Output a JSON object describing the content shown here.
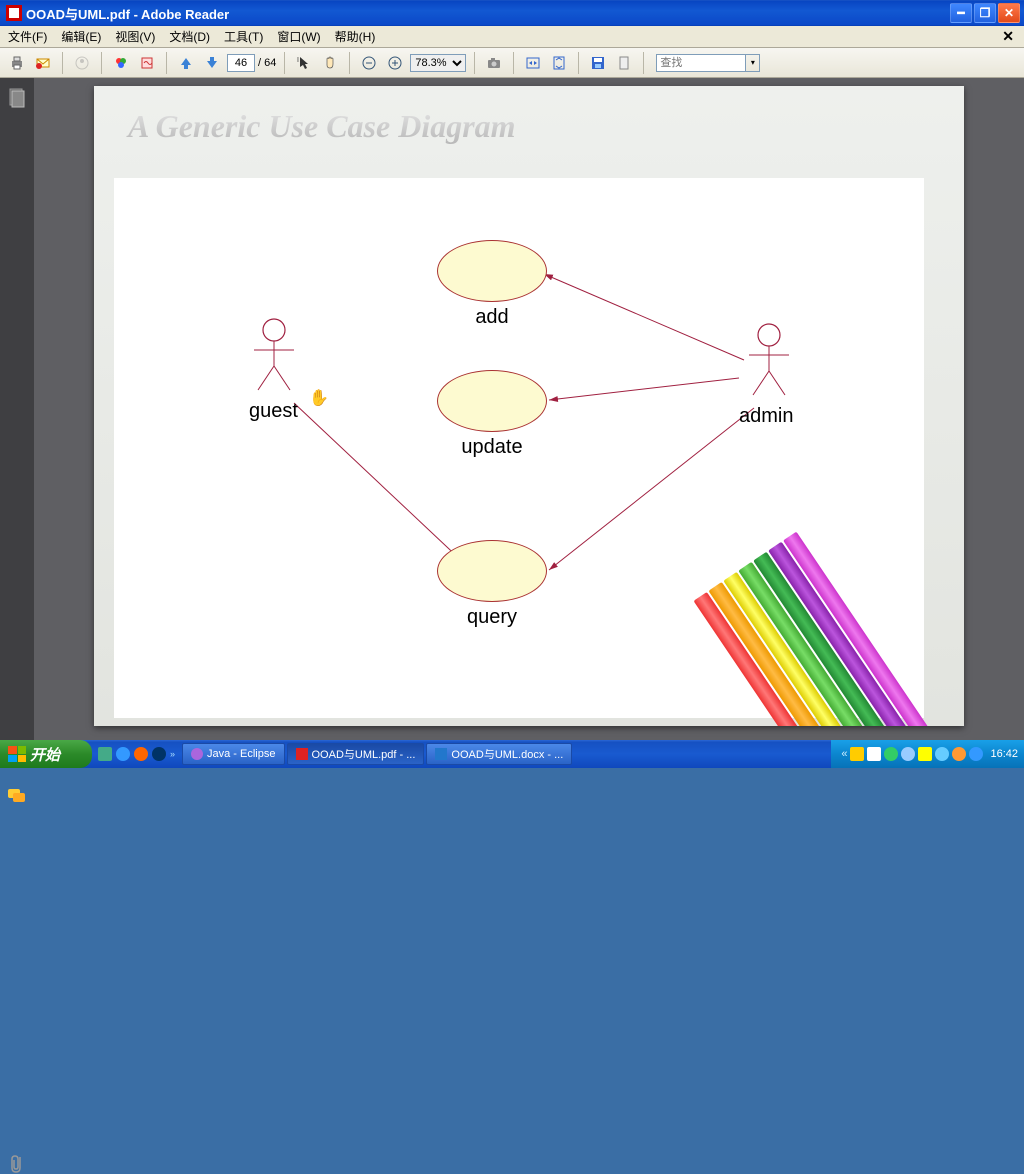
{
  "window": {
    "title": "OOAD与UML.pdf - Adobe Reader"
  },
  "menu": {
    "file": "文件(F)",
    "edit": "编辑(E)",
    "view": "视图(V)",
    "doc": "文档(D)",
    "tools": "工具(T)",
    "window": "窗口(W)",
    "help": "帮助(H)"
  },
  "toolbar": {
    "page": "46",
    "total": "/ 64",
    "zoom": "78.3%",
    "search_placeholder": "查找"
  },
  "slide": {
    "title": "A Generic Use Case Diagram",
    "actors": {
      "guest": "guest",
      "admin": "admin"
    },
    "usecases": {
      "add": "add",
      "update": "update",
      "query": "query"
    }
  },
  "chart_data": {
    "type": "uml-use-case",
    "title": "A Generic Use Case Diagram",
    "actors": [
      "guest",
      "admin"
    ],
    "use_cases": [
      "add",
      "update",
      "query"
    ],
    "associations": [
      {
        "actor": "guest",
        "use_case": "query"
      },
      {
        "actor": "admin",
        "use_case": "add"
      },
      {
        "actor": "admin",
        "use_case": "update"
      },
      {
        "actor": "admin",
        "use_case": "query"
      }
    ]
  },
  "taskbar": {
    "start": "开始",
    "task1": "Java - Eclipse",
    "task2": "OOAD与UML.pdf - ...",
    "task3": "OOAD与UML.docx - ...",
    "clock": "16:42"
  }
}
